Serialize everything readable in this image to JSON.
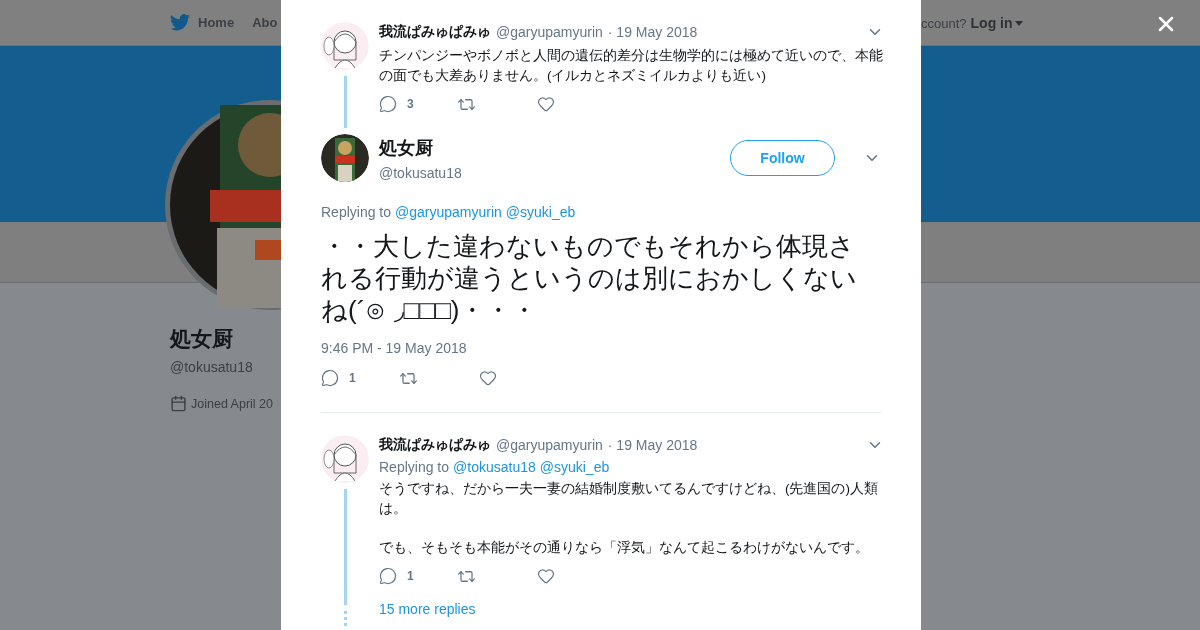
{
  "nav": {
    "items": [
      {
        "label": "Home"
      },
      {
        "label": "Abo"
      }
    ],
    "login_prompt": "ccount?",
    "login": "Log in"
  },
  "profile": {
    "name": "処女厨",
    "handle": "@tokusatu18",
    "joined": "Joined April 20"
  },
  "thread": [
    {
      "kind": "reply",
      "name": "我流ぱみゅぱみゅ",
      "handle": "@garyupamyurin",
      "date": "· 19 May 2018",
      "text": "チンパンジーやボノボと人間の遺伝的差分は生物学的には極めて近いので、本能の面でも大差ありません。(イルカとネズミイルカよりも近い)",
      "replies": "3"
    },
    {
      "kind": "focused",
      "name": "処女厨",
      "handle": "@tokusatu18",
      "follow": "Follow",
      "replying_label": "Replying to",
      "replying_to": [
        "@garyupamyurin",
        "@syuki_eb"
      ],
      "text": "・・大した違わないものでもそれから体現される行動が違うというのは別におかしくないね(´⊙ ◞□□□)・・・",
      "timestamp": "9:46 PM - 19 May 2018",
      "replies": "1"
    },
    {
      "kind": "reply",
      "name": "我流ぱみゅぱみゅ",
      "handle": "@garyupamyurin",
      "date": "· 19 May 2018",
      "replying_label": "Replying to",
      "replying_to": [
        "@tokusatu18",
        "@syuki_eb"
      ],
      "paragraphs": [
        "そうですね、だから一夫一妻の結婚制度敷いてるんですけどね、(先進国の)人類は。",
        "でも、そもそも本能がその通りなら「浮気」なんて起こるわけがないんです。"
      ],
      "replies": "1",
      "more": "15 more replies"
    }
  ]
}
